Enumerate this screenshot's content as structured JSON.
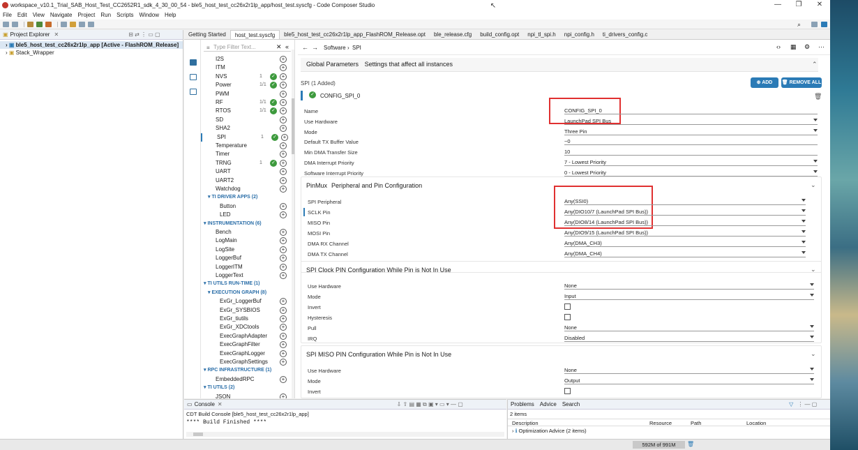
{
  "window": {
    "title": "workspace_v10.1_Trial_SAB_Host_Test_CC2652R1_sdk_4_30_00_54 - ble5_host_test_cc26x2r1lp_app/host_test.syscfg - Code Composer Studio"
  },
  "menu": [
    "File",
    "Edit",
    "View",
    "Navigate",
    "Project",
    "Run",
    "Scripts",
    "Window",
    "Help"
  ],
  "project_explorer": {
    "title": "Project Explorer",
    "items": [
      "ble5_host_test_cc26x2r1lp_app  [Active - FlashROM_Release]",
      "Stack_Wrapper"
    ]
  },
  "editor_tabs": [
    "Getting Started",
    "host_test.syscfg",
    "ble5_host_test_cc26x2r1lp_app_FlashROM_Release.opt",
    "ble_release.cfg",
    "build_config.opt",
    "npi_tl_spi.h",
    "npi_config.h",
    "ti_drivers_config.c"
  ],
  "filter_placeholder": "Type Filter Text...",
  "modules": [
    {
      "name": "I2S",
      "count": "",
      "checked": false
    },
    {
      "name": "ITM",
      "count": "",
      "checked": false
    },
    {
      "name": "NVS",
      "count": "1",
      "checked": true
    },
    {
      "name": "Power",
      "count": "1/1",
      "checked": true
    },
    {
      "name": "PWM",
      "count": "",
      "checked": false
    },
    {
      "name": "RF",
      "count": "1/1",
      "checked": true
    },
    {
      "name": "RTOS",
      "count": "1/1",
      "checked": true
    },
    {
      "name": "SD",
      "count": "",
      "checked": false
    },
    {
      "name": "SHA2",
      "count": "",
      "checked": false
    },
    {
      "name": "SPI",
      "count": "1",
      "checked": true
    },
    {
      "name": "Temperature",
      "count": "",
      "checked": false
    },
    {
      "name": "Timer",
      "count": "",
      "checked": false
    },
    {
      "name": "TRNG",
      "count": "1",
      "checked": true
    },
    {
      "name": "UART",
      "count": "",
      "checked": false
    },
    {
      "name": "UART2",
      "count": "",
      "checked": false
    },
    {
      "name": "Watchdog",
      "count": "",
      "checked": false
    }
  ],
  "categories": {
    "ti_driver_apps": "TI DRIVER APPS (2)",
    "instrumentation": "INSTRUMENTATION (6)",
    "ti_utils_runtime": "TI UTILS RUN-TIME (1)",
    "execution_graph": "EXECUTION GRAPH (8)",
    "rpc_infrastructure": "RPC INFRASTRUCTURE (1)",
    "ti_utils": "TI UTILS (2)"
  },
  "driver_apps": [
    "Button",
    "LED"
  ],
  "instrumentation_items": [
    "Bench",
    "LogMain",
    "LogSite",
    "LoggerBuf",
    "LoggerITM",
    "LoggerText"
  ],
  "exec_graph_items": [
    "ExGr_LoggerBuf",
    "ExGr_SYSBIOS",
    "ExGr_tiutils",
    "ExGr_XDCtools",
    "ExecGraphAdapter",
    "ExecGraphFilter",
    "ExecGraphLogger",
    "ExecGraphSettings"
  ],
  "rpc_items": [
    "EmbeddedRPC"
  ],
  "ti_utils_items": [
    "JSON"
  ],
  "breadcrumb": {
    "software": "Software",
    "sep": "›",
    "current": "SPI"
  },
  "global_params": {
    "title": "Global Parameters",
    "subtitle": "Settings that affect all instances"
  },
  "spi_header": "SPI (1 Added)",
  "buttons": {
    "add": "ADD",
    "remove_all": "REMOVE ALL"
  },
  "instance_name": "CONFIG_SPI_0",
  "fields": [
    {
      "label": "Name",
      "value": "CONFIG_SPI_0",
      "dropdown": false
    },
    {
      "label": "Use Hardware",
      "value": "LaunchPad SPI Bus",
      "dropdown": true
    },
    {
      "label": "Mode",
      "value": "Three Pin",
      "dropdown": true
    },
    {
      "label": "Default TX Buffer Value",
      "value": "~0",
      "dropdown": false
    },
    {
      "label": "Min DMA Transfer Size",
      "value": "10",
      "dropdown": false
    },
    {
      "label": "DMA Interrupt Priority",
      "value": "7 - Lowest Priority",
      "dropdown": true
    },
    {
      "label": "Software Interrupt Priority",
      "value": "0 - Lowest Priority",
      "dropdown": true
    }
  ],
  "pinmux": {
    "title": "PinMux",
    "subtitle": "Peripheral and Pin Configuration",
    "rows": [
      {
        "label": "SPI Peripheral",
        "value": "Any(SSI0)"
      },
      {
        "label": "SCLK Pin",
        "value": "Any(DIO10/7 (LaunchPad SPI Bus))"
      },
      {
        "label": "MISO Pin",
        "value": "Any(DIO8/14 (LaunchPad SPI Bus))"
      },
      {
        "label": "MOSI Pin",
        "value": "Any(DIO9/15 (LaunchPad SPI Bus))"
      },
      {
        "label": "DMA RX Channel",
        "value": "Any(DMA_CH3)"
      },
      {
        "label": "DMA TX Channel",
        "value": "Any(DMA_CH4)"
      }
    ]
  },
  "sclk_cfg": {
    "title": "SPI Clock PIN Configuration While Pin is Not In Use",
    "rows": [
      {
        "label": "Use Hardware",
        "value": "None",
        "type": "dropdown"
      },
      {
        "label": "Mode",
        "value": "Input",
        "type": "dropdown"
      },
      {
        "label": "Invert",
        "value": "",
        "type": "checkbox"
      },
      {
        "label": "Hysteresis",
        "value": "",
        "type": "checkbox"
      },
      {
        "label": "Pull",
        "value": "None",
        "type": "dropdown"
      },
      {
        "label": "IRQ",
        "value": "Disabled",
        "type": "dropdown"
      }
    ]
  },
  "miso_cfg": {
    "title": "SPI MISO PIN Configuration While Pin is Not In Use",
    "rows": [
      {
        "label": "Use Hardware",
        "value": "None",
        "type": "dropdown"
      },
      {
        "label": "Mode",
        "value": "Output",
        "type": "dropdown"
      },
      {
        "label": "Invert",
        "value": "",
        "type": "checkbox"
      }
    ]
  },
  "console": {
    "title": "Console",
    "subtitle": "CDT Build Console [ble5_host_test_cc26x2r1lp_app]",
    "output": "**** Build Finished ****"
  },
  "problems": {
    "tabs": [
      "Problems",
      "Advice",
      "Search"
    ],
    "count": "2 items",
    "columns": [
      "Description",
      "Resource",
      "Path",
      "Location"
    ],
    "row": "Optimization Advice (2 items)"
  },
  "status": {
    "memory": "592M of 991M"
  },
  "colors": {
    "accent": "#2b7bb6",
    "check": "#3d9a3d",
    "highlight": "#e03030"
  }
}
